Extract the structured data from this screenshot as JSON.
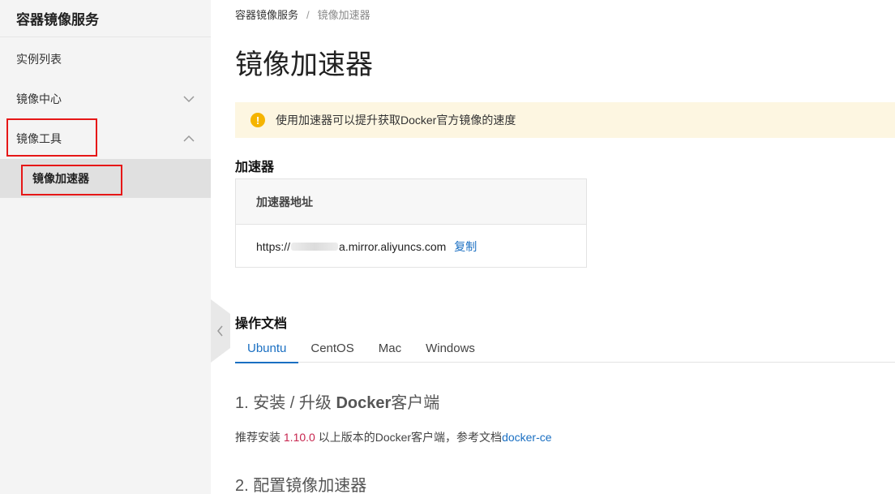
{
  "sidebar": {
    "title": "容器镜像服务",
    "items": [
      {
        "label": "实例列表"
      },
      {
        "label": "镜像中心",
        "state": "collapsed"
      },
      {
        "label": "镜像工具",
        "state": "expanded"
      }
    ],
    "sub_item": {
      "label": "镜像加速器"
    }
  },
  "breadcrumb": {
    "parent": "容器镜像服务",
    "separator": "/",
    "current": "镜像加速器"
  },
  "page_title": "镜像加速器",
  "alert": {
    "icon": "warning-icon",
    "icon_glyph": "!",
    "text": "使用加速器可以提升获取Docker官方镜像的速度",
    "color": "#fdf6e1"
  },
  "accelerator": {
    "section_title": "加速器",
    "column_header": "加速器地址",
    "url_prefix": "https://",
    "url_suffix": "a.mirror.aliyuncs.com",
    "copy_label": "复制"
  },
  "docs": {
    "section_title": "操作文档",
    "tabs": [
      "Ubuntu",
      "CentOS",
      "Mac",
      "Windows"
    ],
    "active_tab": "Ubuntu",
    "step1": {
      "num": "1.",
      "pre": "安装 / 升级",
      "bold": "Docker",
      "post": "客户端"
    },
    "step1_text": {
      "pre": "推荐安装 ",
      "version": "1.10.0",
      "mid": " 以上版本的Docker客户端，参考文档",
      "link": "docker-ce"
    },
    "step2": "2. 配置镜像加速器"
  },
  "colors": {
    "accent": "#1a6fc2",
    "highlight_box": "#e61717",
    "version": "#c7254e"
  }
}
